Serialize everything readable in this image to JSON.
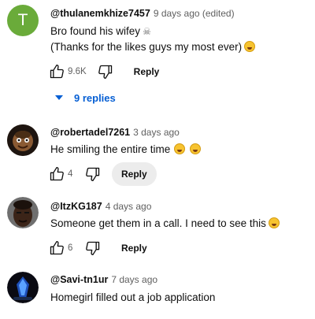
{
  "comments": [
    {
      "author": "@thulanemkhize7457",
      "meta": "9 days ago (edited)",
      "avatar_letter": "T",
      "avatar_color": "#6aab3a",
      "lines": [
        "Bro found his wifey",
        "(Thanks for the likes guys my most ever)"
      ],
      "likes": "9.6K",
      "reply_label": "Reply",
      "replies_label": "9 replies"
    },
    {
      "author": "@robertadel7261",
      "meta": "3 days ago",
      "lines": [
        "He smiling the entire time"
      ],
      "likes": "4",
      "reply_label": "Reply"
    },
    {
      "author": "@ItzKG187",
      "meta": "4 days ago",
      "lines": [
        "Someone get them in a call. I need to see this"
      ],
      "likes": "6",
      "reply_label": "Reply"
    },
    {
      "author": "@Savi-tn1ur",
      "meta": "7 days ago",
      "lines": [
        "Homegirl filled out a job application"
      ]
    }
  ],
  "icons": {
    "like": "thumbs-up-icon",
    "dislike": "thumbs-down-icon",
    "skull": "skull-emoji",
    "laugh": "laughing-emoji",
    "replies": "triangle-down-icon"
  },
  "colors": {
    "link": "#065fd4",
    "meta": "#606060"
  }
}
